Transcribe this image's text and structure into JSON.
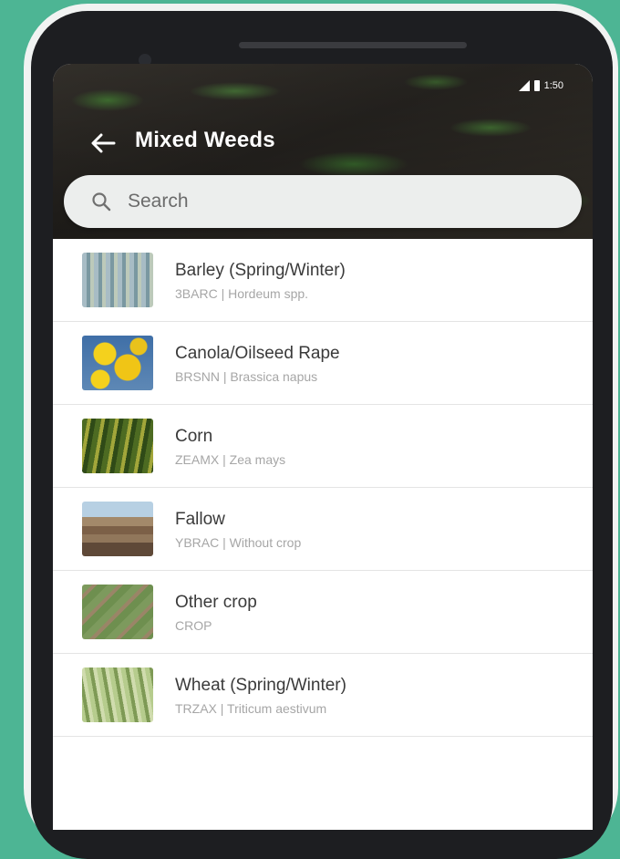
{
  "status_bar": {
    "time": "1:50"
  },
  "header": {
    "title": "Mixed Weeds"
  },
  "search": {
    "placeholder": "Search",
    "value": ""
  },
  "crops": [
    {
      "name": "Barley (Spring/Winter)",
      "subtitle": "3BARC | Hordeum spp."
    },
    {
      "name": "Canola/Oilseed Rape",
      "subtitle": "BRSNN | Brassica napus"
    },
    {
      "name": "Corn",
      "subtitle": "ZEAMX | Zea mays"
    },
    {
      "name": "Fallow",
      "subtitle": "YBRAC | Without crop"
    },
    {
      "name": "Other crop",
      "subtitle": "CROP"
    },
    {
      "name": "Wheat (Spring/Winter)",
      "subtitle": "TRZAX | Triticum aestivum"
    }
  ],
  "colors": {
    "background": "#4db594",
    "item_title": "#3a3a3a",
    "item_subtitle": "#a6a6a6",
    "search_bar": "#eceeed"
  }
}
